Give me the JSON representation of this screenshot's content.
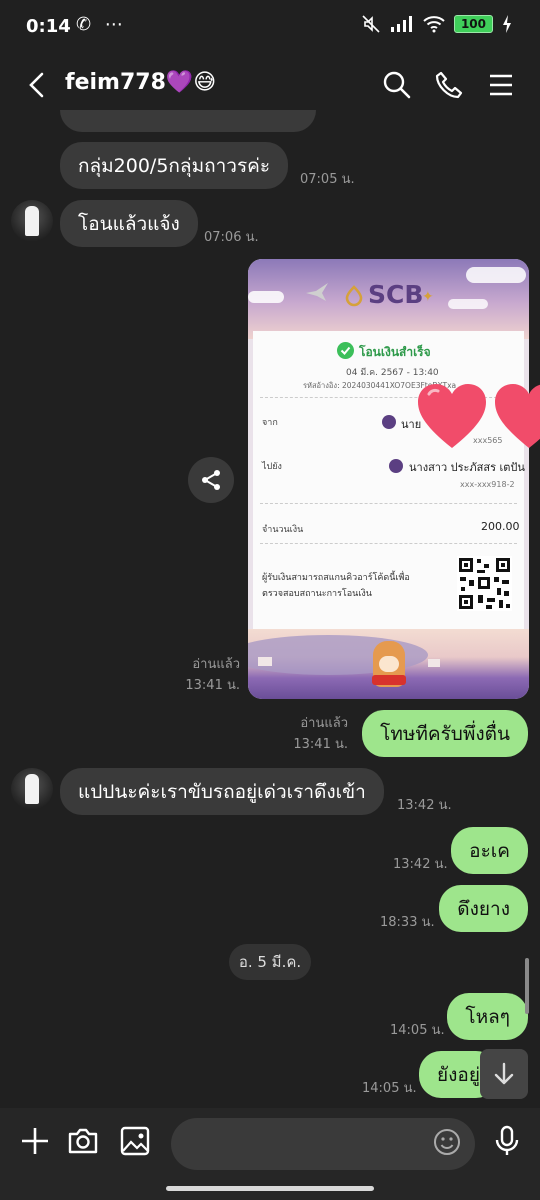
{
  "status": {
    "time": "0:14",
    "left_icons": "✆ ⋯",
    "battery": "100"
  },
  "header": {
    "title": "feim778💜😅"
  },
  "messages": {
    "m1": {
      "text": "กลุ่ม200/5กลุ่มถาวรค่ะ",
      "time": "07:05 น."
    },
    "m2": {
      "text": "โอนแล้วแจ้ง",
      "time": "07:06 น."
    },
    "slip_meta": {
      "read": "อ่านแล้ว",
      "time": "13:41 น."
    },
    "m3": {
      "text": "โทษทีครับพึ่งตื่น",
      "read": "อ่านแล้ว",
      "time": "13:41 น."
    },
    "m4": {
      "text": "แปปนะค่ะเราขับรถอยู่เด่วเราดึงเข้า",
      "time": "13:42 น."
    },
    "m5": {
      "text": "อะเค",
      "time": "13:42 น."
    },
    "m6": {
      "text": "ดึงยาง",
      "time": "18:33 น."
    },
    "date_divider": "อ. 5 มี.ค.",
    "m7": {
      "text": "โหลๆ",
      "time": "14:05 น."
    },
    "m8": {
      "text": "ยังอยู่",
      "time": "14:05 น."
    }
  },
  "slip": {
    "bank": "SCB",
    "status": "โอนเงินสำเร็จ",
    "date": "04 มี.ค. 2567 - 13:40",
    "ref": "รหัสอ้างอิง: 2024030441XO7OE3FteBXTxa",
    "from_label": "จาก",
    "from_name": "นาย",
    "from_account": "xxx565",
    "to_label": "ไปยัง",
    "to_name": "นางสาว ประภัสสร เตปัน",
    "to_account": "xxx-xxx918-2",
    "amount_label": "จำนวนเงิน",
    "amount": "200.00",
    "qr_note_1": "ผู้รับเงินสามารถสแกนคิวอาร์โค้ดนี้เพื่อ",
    "qr_note_2": "ตรวจสอบสถานะการโอนเงิน"
  },
  "icons": {
    "back": "chevron-left-icon",
    "search": "search-icon",
    "call": "phone-icon",
    "menu": "menu-icon",
    "share": "share-icon",
    "scroll": "arrow-down-icon",
    "plus": "plus-icon",
    "camera": "camera-icon",
    "gallery": "image-icon",
    "emoji": "emoji-icon",
    "mic": "mic-icon"
  },
  "colors": {
    "bg": "#202020",
    "incoming": "#3a3a3a",
    "outgoing": "#9ee58c",
    "slip_purple": "#5b3f82",
    "success": "#3cbf5a"
  },
  "input": {
    "placeholder": ""
  }
}
